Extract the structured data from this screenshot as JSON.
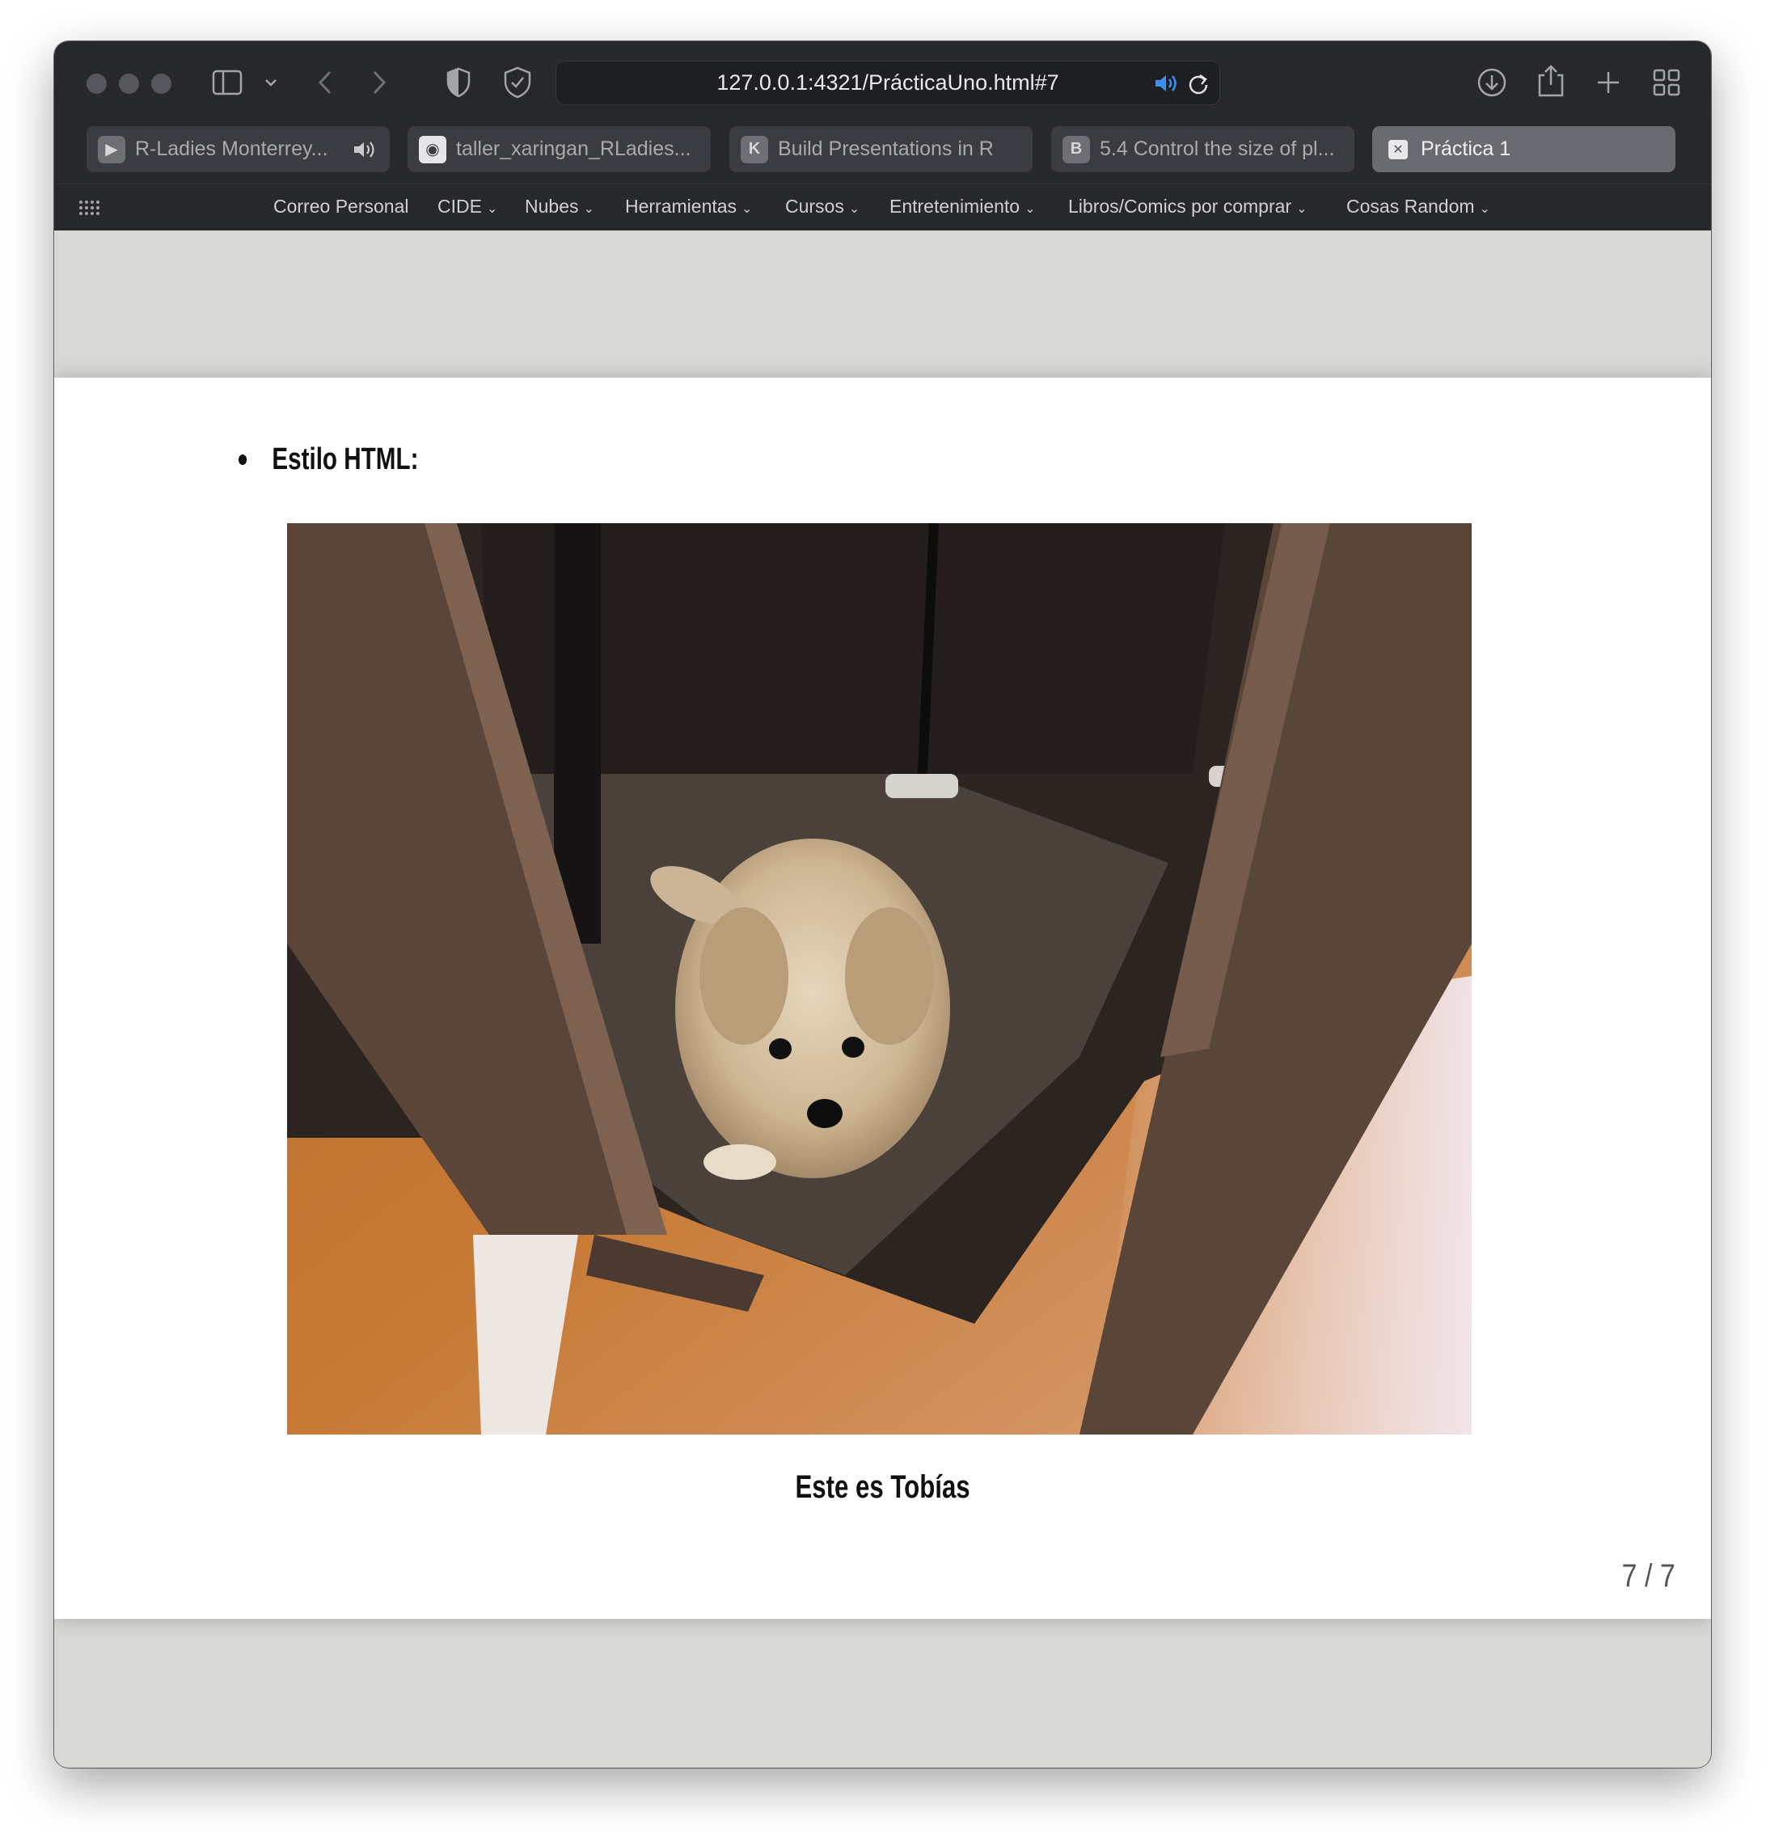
{
  "browser": {
    "url": "127.0.0.1:4321/PrácticaUno.html#7",
    "tabs": [
      {
        "label": "R-Ladies Monterrey...",
        "favicon": "▶",
        "audio": true,
        "active": false
      },
      {
        "label": "taller_xaringan_RLadies...",
        "favicon": "◉",
        "active": false
      },
      {
        "label": "Build Presentations in R",
        "favicon": "K",
        "active": false
      },
      {
        "label": "5.4 Control the size of pl...",
        "favicon": "B",
        "active": false
      },
      {
        "label": "Práctica 1",
        "favicon": "✕",
        "active": true
      }
    ],
    "bookmarks": [
      {
        "label": "Correo Personal",
        "menu": false
      },
      {
        "label": "CIDE",
        "menu": true
      },
      {
        "label": "Nubes",
        "menu": true
      },
      {
        "label": "Herramientas",
        "menu": true
      },
      {
        "label": "Cursos",
        "menu": true
      },
      {
        "label": "Entretenimiento",
        "menu": true
      },
      {
        "label": "Libros/Comics por comprar",
        "menu": true
      },
      {
        "label": "Cosas Random",
        "menu": true
      }
    ]
  },
  "slide": {
    "bullet": "Estilo HTML:",
    "caption": "Este es Tobías",
    "page": "7 / 7"
  }
}
